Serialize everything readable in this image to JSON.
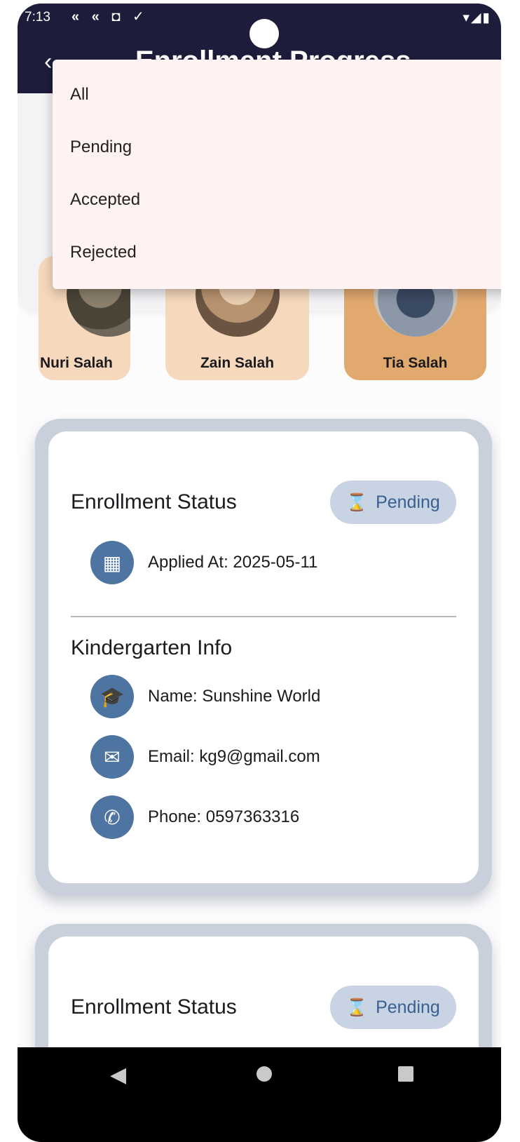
{
  "status_bar": {
    "time": "7:13",
    "left_icons": "« « ◘ ✓",
    "right_icons": "▾◢▮"
  },
  "app_bar": {
    "title": "Enrollment Progress"
  },
  "children": [
    {
      "name": "Nuri Salah"
    },
    {
      "name": "Zain Salah"
    },
    {
      "name": "Tia Salah"
    }
  ],
  "dropdown": {
    "options": [
      "All",
      "Pending",
      "Accepted",
      "Rejected"
    ]
  },
  "enrollments": [
    {
      "status_label": "Enrollment Status",
      "status": "Pending",
      "applied": "Applied At: 2025-05-11",
      "kg_title": "Kindergarten Info",
      "name": "Name: Sunshine World",
      "email": "Email: kg9@gmail.com",
      "phone": "Phone: 0597363316"
    },
    {
      "status_label": "Enrollment Status",
      "status": "Pending"
    }
  ],
  "colors": {
    "app_bar": "#1d1c3a",
    "accent": "#4e74a1",
    "pill_bg": "#c8d3e4",
    "child_selected": "#e1a96e",
    "child": "#f6d8bc",
    "menu_bg": "#fff2f2"
  }
}
